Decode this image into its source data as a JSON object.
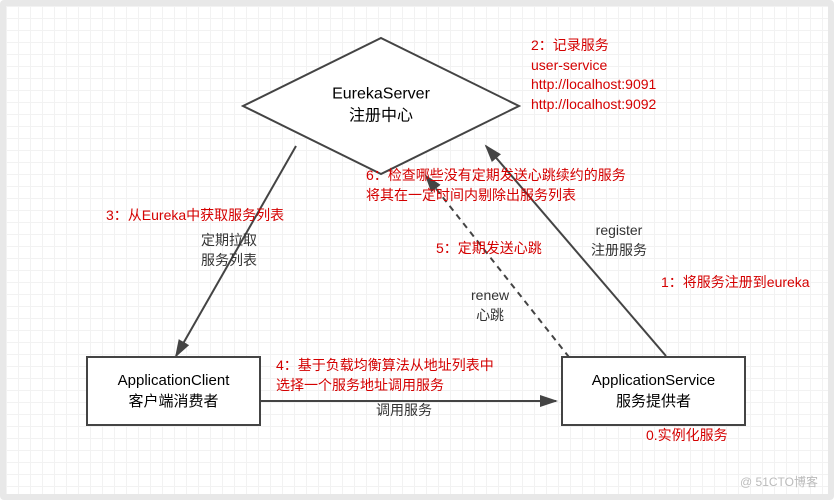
{
  "nodes": {
    "server": {
      "title": "EurekaServer",
      "subtitle": "注册中心"
    },
    "client": {
      "title": "ApplicationClient",
      "subtitle": "客户端消费者"
    },
    "service": {
      "title": "ApplicationService",
      "subtitle": "服务提供者"
    }
  },
  "edges": {
    "pull": {
      "line1": "定期拉取",
      "line2": "服务列表"
    },
    "renew": {
      "line1": "renew",
      "line2": "心跳"
    },
    "register": {
      "line1": "register",
      "line2": "注册服务"
    },
    "invoke": {
      "line1": "调用服务"
    }
  },
  "annotations": {
    "a0": "0.实例化服务",
    "a1": "1：将服务注册到eureka",
    "a2_l1": "2：记录服务",
    "a2_l2": "user-service",
    "a2_l3": "http://localhost:9091",
    "a2_l4": "http://localhost:9092",
    "a3": "3：从Eureka中获取服务列表",
    "a4_l1": "4：基于负载均衡算法从地址列表中",
    "a4_l2": "选择一个服务地址调用服务",
    "a5": "5：定期发送心跳",
    "a6_l1": "6：检查哪些没有定期发送心跳续约的服务",
    "a6_l2": "将其在一定时间内剔除出服务列表"
  },
  "watermark": "@ 51CTO博客"
}
